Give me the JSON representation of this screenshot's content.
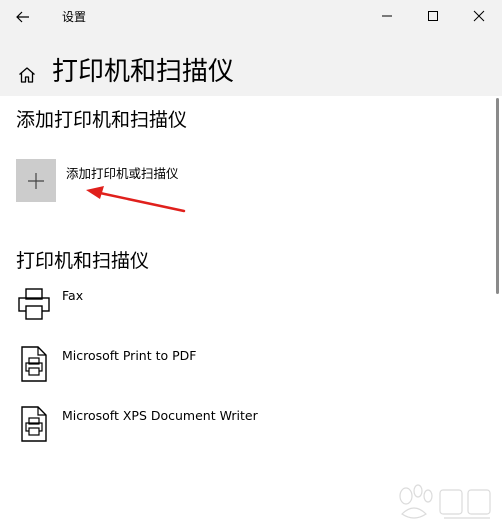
{
  "window": {
    "title": "设置"
  },
  "header": {
    "page_title": "打印机和扫描仪"
  },
  "add_section": {
    "title": "添加打印机和扫描仪",
    "add_button_label": "添加打印机或扫描仪"
  },
  "devices_section": {
    "title": "打印机和扫描仪",
    "devices": [
      {
        "name": "Fax",
        "icon": "fax-printer-icon"
      },
      {
        "name": "Microsoft Print to PDF",
        "icon": "printer-driver-icon"
      },
      {
        "name": "Microsoft XPS Document Writer",
        "icon": "printer-driver-icon"
      }
    ]
  },
  "icons": {
    "back": "arrow-left-icon",
    "minimize": "minimize-icon",
    "maximize": "maximize-icon",
    "close": "close-icon",
    "home": "home-icon",
    "add": "plus-icon"
  },
  "colors": {
    "titlebar_bg": "#f2f2f2",
    "add_tile_bg": "#cccccc",
    "annotation_arrow": "#e0201c"
  }
}
